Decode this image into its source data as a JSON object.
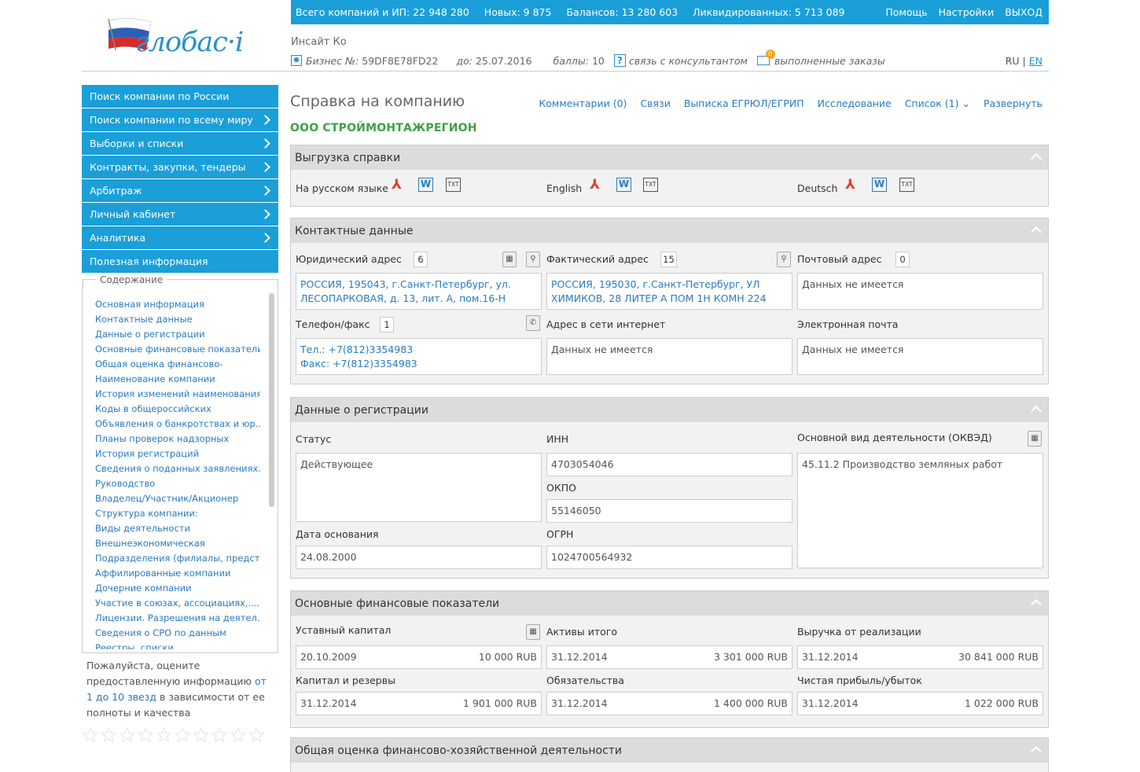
{
  "brand": {
    "logo_text": "глобас·i"
  },
  "topbar": {
    "stats": [
      "Всего компаний и ИП: 22 948 280",
      "Новых:  9 875",
      "Балансов:  13 280 603",
      "Ликвидированных:  5 713 089"
    ],
    "links": [
      "Помощь",
      "Настройки",
      "ВЫХОД"
    ]
  },
  "user": {
    "name": "Инсайт Ко",
    "business_label": "Бизнес №:",
    "business_no": "59DF8E78FD22",
    "until_label": "до:",
    "until_date": "25.07.2016",
    "points_label": "баллы:",
    "points": "10",
    "consult": "связь с консультантом",
    "orders": "выполненные заказы",
    "orders_badge": "0"
  },
  "lang": {
    "ru": "RU",
    "sep": "|",
    "en": "EN"
  },
  "menu": [
    {
      "label": "Поиск компании по России",
      "chevron": false
    },
    {
      "label": "Поиск компании по всему миру",
      "chevron": true
    },
    {
      "label": "Выборки и списки",
      "chevron": true
    },
    {
      "label": "Контракты, закупки, тендеры",
      "chevron": true
    },
    {
      "label": "Арбитраж",
      "chevron": true
    },
    {
      "label": "Личный кабинет",
      "chevron": true
    },
    {
      "label": "Аналитика",
      "chevron": true
    },
    {
      "label": "Полезная информация",
      "chevron": false
    }
  ],
  "toc": {
    "title": "Содержание",
    "items": [
      "Основная информация",
      "Контактные данные",
      "Данные о регистрации",
      "Основные финансовые показатели",
      "Общая оценка финансово-",
      "Наименование компании",
      "История изменений наименования",
      "Коды в общероссийских",
      "Объявления о банкротствах и юр.....",
      "Планы проверок надзорных",
      "История регистраций",
      "Сведения о поданных заявлениях.....",
      "Руководство",
      "Владелец/Участник/Акционер",
      "Структура компании:",
      "Виды деятельности",
      "Внешнеэкономическая",
      "Подразделения (филиалы, предст.....",
      "Аффилированные компании",
      "Дочерние компании",
      "Участие в союзах, ассоциациях,....",
      "Лицензии. Разрешения на деятел.....",
      "Сведения о СРО по данным",
      "Реестры, списки"
    ]
  },
  "rating": {
    "text1": "Пожалуйста, оцените предоставленную информацию ",
    "link": "от 1 до 10 звезд",
    "text2": " в зависимости от ее полноты и качества",
    "stars": 10
  },
  "page": {
    "title": "Справка на компанию",
    "tabs": [
      "Комментарии (0)",
      "Связи",
      "Выписка ЕГРЮЛ/ЕГРИП",
      "Исследование",
      "Список (1) ⌄",
      "Развернуть"
    ],
    "company": "ООО СТРОЙМОНТАЖРЕГИОН"
  },
  "export": {
    "title": "Выгрузка справки",
    "langs": [
      "На русском языке",
      "English",
      "Deutsch"
    ],
    "word_icon": "W",
    "txt_icon": "TXT"
  },
  "contacts": {
    "title": "Контактные данные",
    "legal_label": "Юридический адрес",
    "legal_count": "6",
    "legal_value": "РОССИЯ, 195043, г.Санкт-Петербург, ул. ЛЕСОПАРКОВАЯ, д. 13, лит. А, пом.16-Н",
    "actual_label": "Фактический адрес",
    "actual_count": "15",
    "actual_value": "РОССИЯ, 195030, г.Санкт-Петербург, УЛ ХИМИКОВ, 28 ЛИТЕР А ПОМ 1Н КОМН 224",
    "postal_label": "Почтовый адрес",
    "postal_count": "0",
    "postal_value": "Данных не имеется",
    "phone_label": "Телефон/факс",
    "phone_count": "1",
    "phone_value_1": "Тел.: +7(812)3354983",
    "phone_value_2": "Факс: +7(812)3354983",
    "web_label": "Адрес в сети интернет",
    "web_value": "Данных не имеется",
    "email_label": "Электронная почта",
    "email_value": "Данных не имеется"
  },
  "registration": {
    "title": "Данные о регистрации",
    "status_label": "Статус",
    "status_value": "Действующее",
    "inn_label": "ИНН",
    "inn_value": "4703054046",
    "okpo_label": "ОКПО",
    "okpo_value": "55146050",
    "okved_label": "Основной вид деятельности (ОКВЭД)",
    "okved_value": "45.11.2 Производство земляных работ",
    "founded_label": "Дата основания",
    "founded_value": "24.08.2000",
    "ogrn_label": "ОГРН",
    "ogrn_value": "1024700564932"
  },
  "finance": {
    "title": "Основные финансовые показатели",
    "items": [
      {
        "label": "Уставный капитал",
        "date": "20.10.2009",
        "amount": "10 000 RUB"
      },
      {
        "label": "Активы итого",
        "date": "31.12.2014",
        "amount": "3 301 000 RUB"
      },
      {
        "label": "Выручка от реализации",
        "date": "31.12.2014",
        "amount": "30 841 000 RUB"
      },
      {
        "label": "Капитал и резервы",
        "date": "31.12.2014",
        "amount": "1 901 000 RUB"
      },
      {
        "label": "Обязательства",
        "date": "31.12.2014",
        "amount": "1 400 000 RUB"
      },
      {
        "label": "Чистая прибыль/убыток",
        "date": "31.12.2014",
        "amount": "1 022 000 RUB"
      }
    ]
  },
  "assessment": {
    "title": "Общая оценка финансово-хозяйственной деятельности"
  },
  "colors": {
    "accent": "#1a9fd9",
    "link": "#2a7bc0",
    "company": "#3aa241"
  }
}
